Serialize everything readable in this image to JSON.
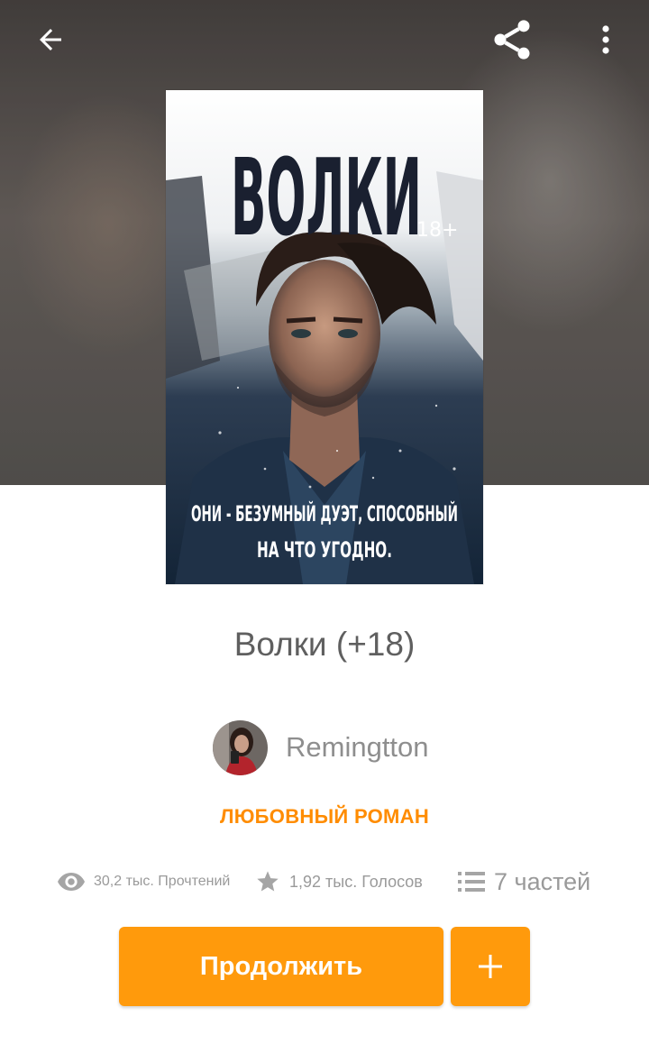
{
  "header": {
    "back_icon": "arrow-left-icon",
    "share_icon": "share-icon",
    "more_icon": "more-vertical-icon"
  },
  "cover": {
    "title_text": "ВОЛКИ",
    "age_text": "18+",
    "tagline_line1": "ОНИ - БЕЗУМНЫЙ ДУЭТ, СПОСОБНЫЙ",
    "tagline_line2": "НА ЧТО УГОДНО."
  },
  "book": {
    "title": "Волки (+18)",
    "author": "Remingtton",
    "genre": "ЛЮБОВНЫЙ РОМАН"
  },
  "stats": {
    "reads": "30,2 тыс. Прочтений",
    "votes": "1,92 тыс. Голосов",
    "parts": "7 частей"
  },
  "actions": {
    "continue_label": "Продолжить",
    "add_icon": "plus-icon"
  },
  "colors": {
    "accent": "#ff9a0c",
    "genre": "#ff8c00"
  }
}
